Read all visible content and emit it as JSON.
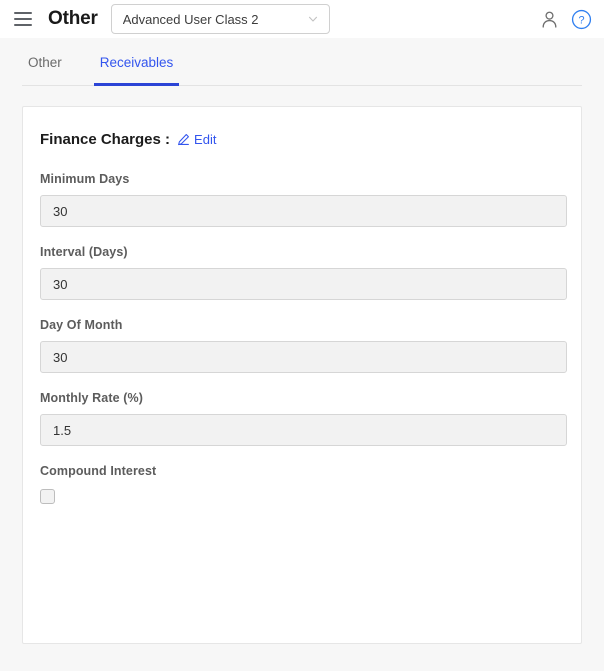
{
  "topbar": {
    "menu_icon": "hamburger-menu-icon",
    "app_title": "Other",
    "class_select": {
      "value": "Advanced User Class 2",
      "chevron_icon": "chevron-down-icon"
    },
    "user_icon": "user-account-icon",
    "help_icon": "help-circle-icon"
  },
  "tabs": [
    {
      "label": "Other",
      "active": false
    },
    {
      "label": "Receivables",
      "active": true
    }
  ],
  "card": {
    "title": "Finance Charges :",
    "edit": {
      "label": "Edit",
      "icon": "pencil-edit-icon"
    },
    "fields": [
      {
        "label": "Minimum Days",
        "value": "30",
        "type": "text"
      },
      {
        "label": "Interval (Days)",
        "value": "30",
        "type": "text"
      },
      {
        "label": "Day Of Month",
        "value": "30",
        "type": "text"
      },
      {
        "label": "Monthly Rate (%)",
        "value": "1.5",
        "type": "text"
      },
      {
        "label": "Compound Interest",
        "value": "",
        "type": "checkbox",
        "checked": false
      }
    ]
  },
  "colors": {
    "accent_blue": "#3355ee",
    "tab_underline": "#2b44d6",
    "page_bg": "#f7f7f7",
    "card_bg": "#ffffff",
    "input_bg": "#f2f2f2",
    "label_gray": "#5c5c5c"
  }
}
